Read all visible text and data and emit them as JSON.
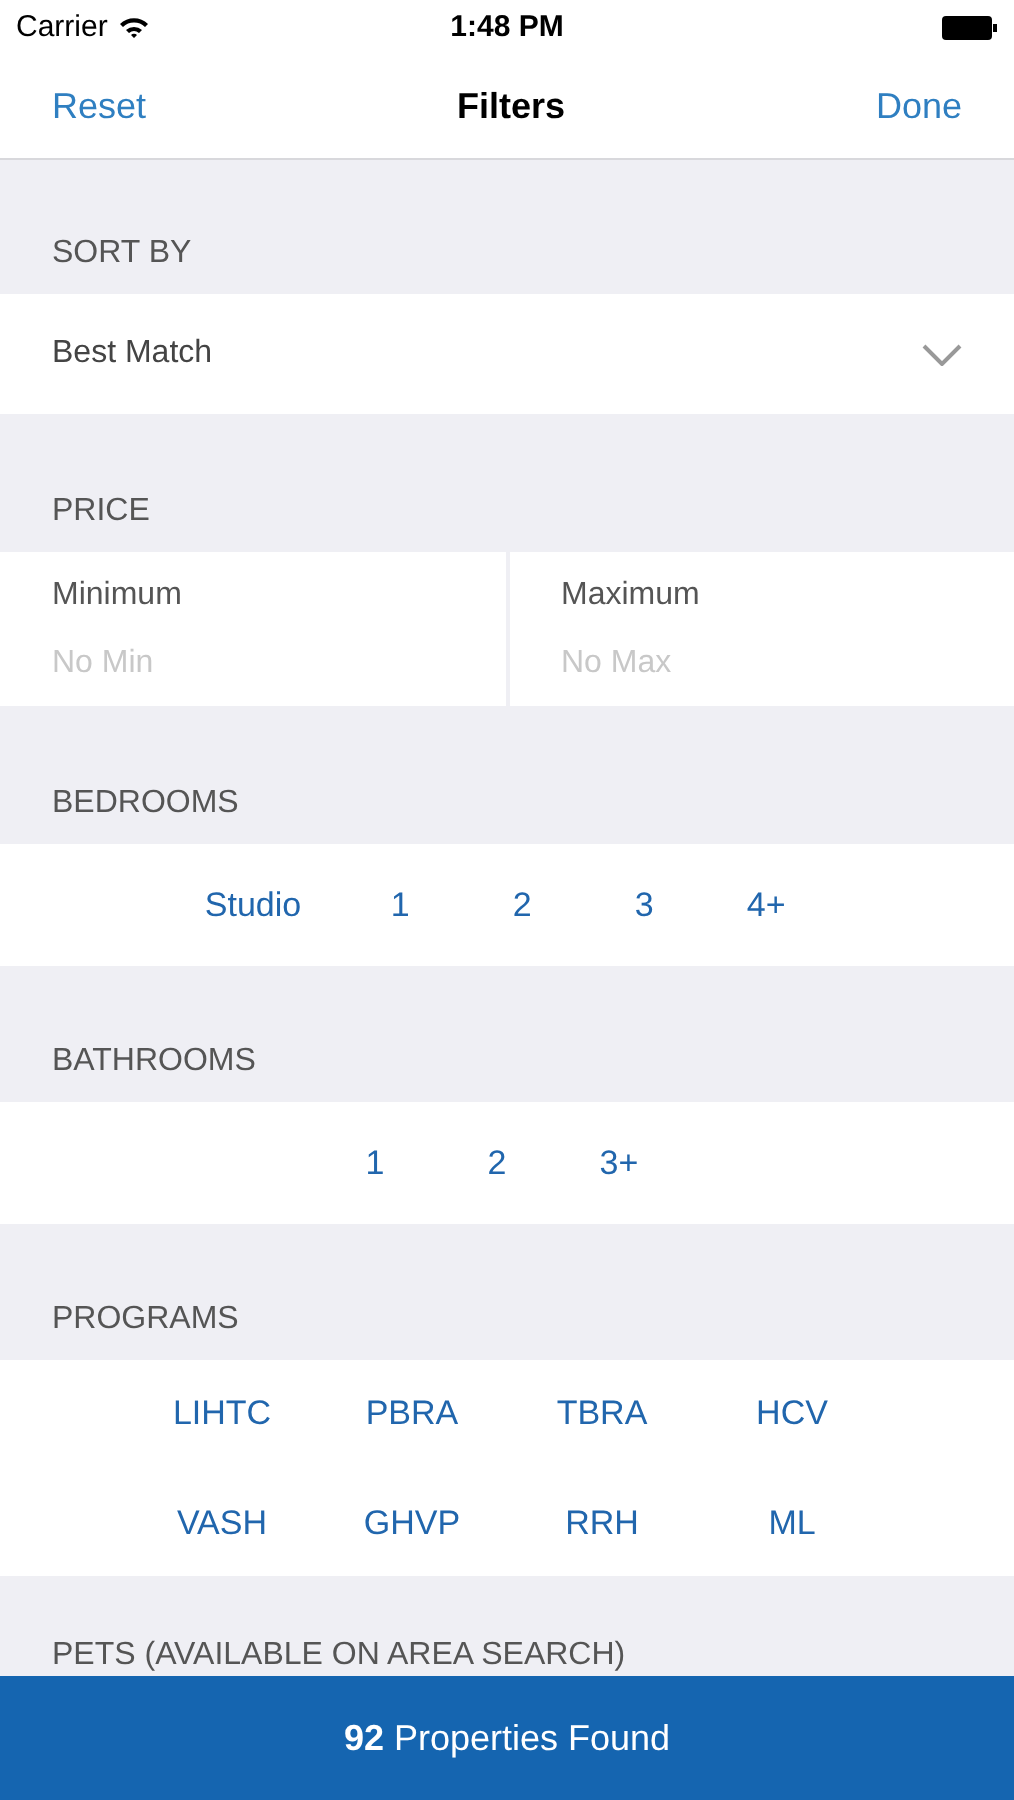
{
  "status_bar": {
    "carrier": "Carrier",
    "time": "1:48 PM"
  },
  "nav": {
    "left": "Reset",
    "title": "Filters",
    "right": "Done"
  },
  "sort": {
    "header": "SORT BY",
    "value": "Best Match"
  },
  "price": {
    "header": "PRICE",
    "fields": [
      {
        "label": "Minimum",
        "placeholder": "No Min"
      },
      {
        "label": "Maximum",
        "placeholder": "No Max"
      }
    ]
  },
  "bedrooms": {
    "header": "BEDROOMS",
    "options": [
      "Studio",
      "1",
      "2",
      "3",
      "4+"
    ]
  },
  "bathrooms": {
    "header": "BATHROOMS",
    "options": [
      "1",
      "2",
      "3+"
    ]
  },
  "programs": {
    "header": "PROGRAMS",
    "rows": [
      [
        "LIHTC",
        "PBRA",
        "TBRA",
        "HCV"
      ],
      [
        "VASH",
        "GHVP",
        "RRH",
        "ML"
      ]
    ]
  },
  "pets": {
    "header": "PETS (AVAILABLE ON AREA SEARCH)"
  },
  "results_button": {
    "count": "92",
    "label": "Properties Found"
  }
}
